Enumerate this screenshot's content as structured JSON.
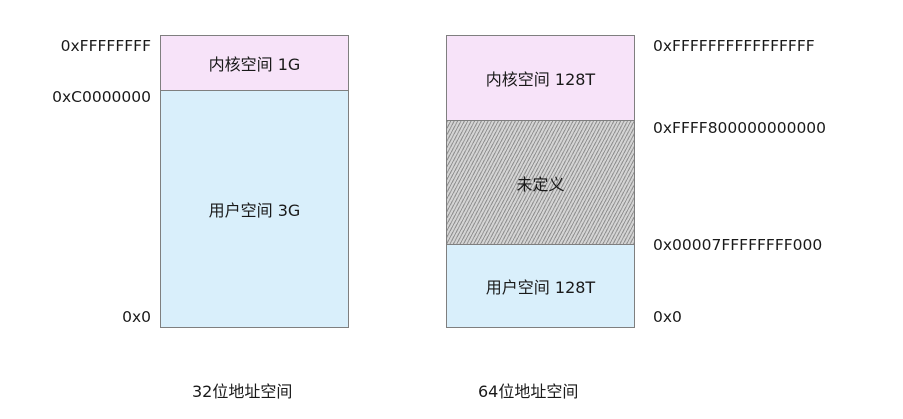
{
  "space32": {
    "caption": "32位地址空间",
    "kernel_label": "内核空间 1G",
    "user_label": "用户空间 3G",
    "addr_top": "0xFFFFFFFF",
    "addr_split": "0xC0000000",
    "addr_bottom": "0x0",
    "colors": {
      "kernel": "#f7e3f9",
      "user": "#d9effb"
    }
  },
  "space64": {
    "caption": "64位地址空间",
    "kernel_label": "内核空间 128T",
    "undefined_label": "未定义",
    "user_label": "用户空间 128T",
    "addr_top": "0xFFFFFFFFFFFFFFFF",
    "addr_kernel_start": "0xFFFF800000000000",
    "addr_user_end": "0x00007FFFFFFFF000",
    "addr_bottom": "0x0",
    "colors": {
      "kernel": "#f7e3f9",
      "undefined": "#d4d4d4",
      "user": "#d9effb"
    }
  }
}
